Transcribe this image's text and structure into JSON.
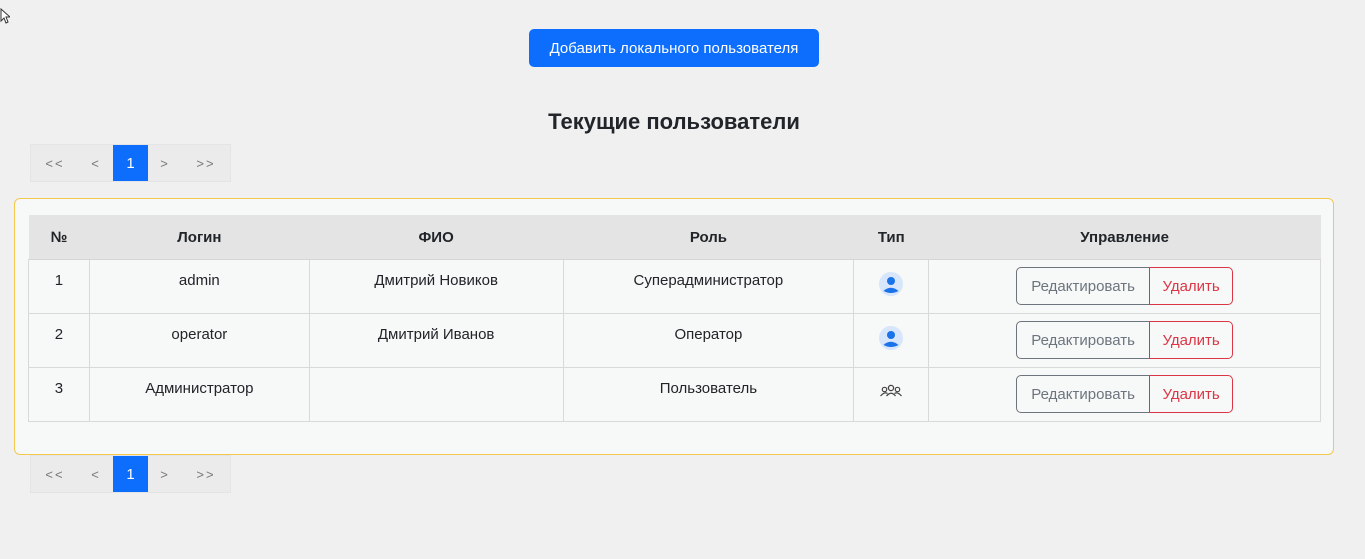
{
  "toolbar": {
    "add_label": "Добавить локального пользователя"
  },
  "page_title": "Текущие пользователи",
  "pagination": {
    "first": "<<",
    "prev": "<",
    "current": "1",
    "next": ">",
    "last": ">>"
  },
  "table": {
    "headers": {
      "num": "№",
      "login": "Логин",
      "fio": "ФИО",
      "role": "Роль",
      "type": "Тип",
      "manage": "Управление"
    },
    "rows": [
      {
        "num": "1",
        "login": "admin",
        "fio": "Дмитрий Новиков",
        "role": "Суперадминистратор",
        "type_icon": "user-icon",
        "edit": "Редактировать",
        "delete": "Удалить"
      },
      {
        "num": "2",
        "login": "operator",
        "fio": "Дмитрий Иванов",
        "role": "Оператор",
        "type_icon": "user-icon",
        "edit": "Редактировать",
        "delete": "Удалить"
      },
      {
        "num": "3",
        "login": "Администратор",
        "fio": "",
        "role": "Пользователь",
        "type_icon": "group-icon",
        "edit": "Редактировать",
        "delete": "Удалить"
      }
    ]
  },
  "colors": {
    "primary": "#0d6efd",
    "danger": "#dc3545",
    "secondary": "#6c757d",
    "card_border": "#f2c94c"
  }
}
